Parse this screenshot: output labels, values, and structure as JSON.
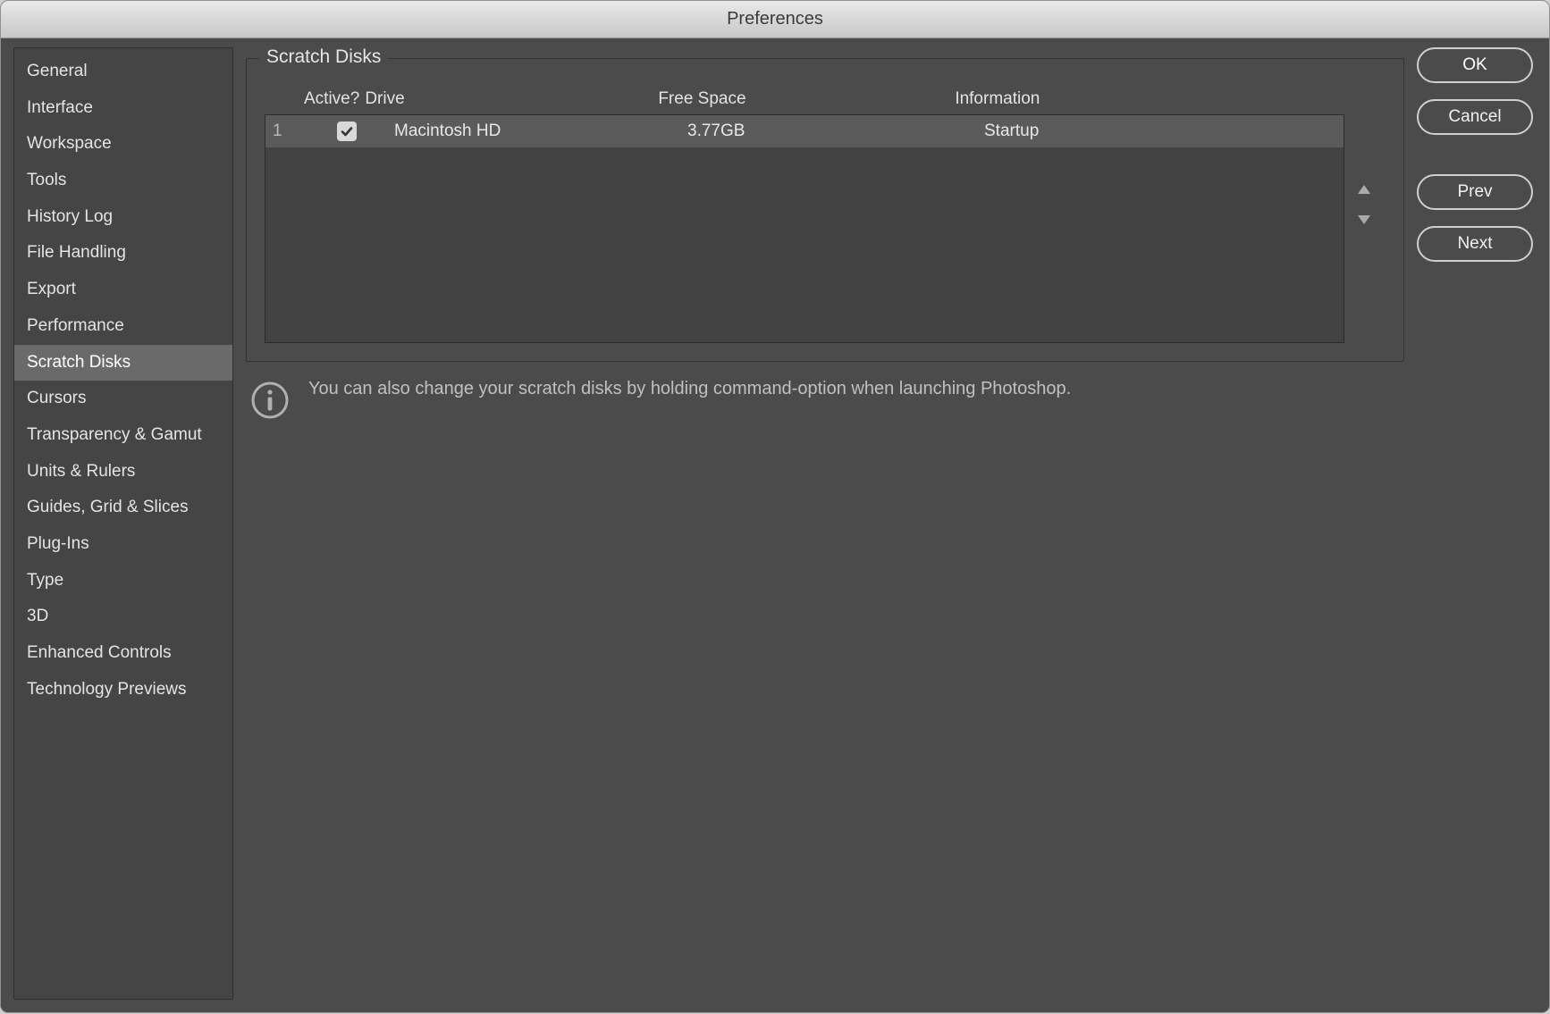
{
  "window": {
    "title": "Preferences"
  },
  "sidebar": {
    "items": [
      {
        "label": "General"
      },
      {
        "label": "Interface"
      },
      {
        "label": "Workspace"
      },
      {
        "label": "Tools"
      },
      {
        "label": "History Log"
      },
      {
        "label": "File Handling"
      },
      {
        "label": "Export"
      },
      {
        "label": "Performance"
      },
      {
        "label": "Scratch Disks",
        "selected": true
      },
      {
        "label": "Cursors"
      },
      {
        "label": "Transparency & Gamut"
      },
      {
        "label": "Units & Rulers"
      },
      {
        "label": "Guides, Grid & Slices"
      },
      {
        "label": "Plug-Ins"
      },
      {
        "label": "Type"
      },
      {
        "label": "3D"
      },
      {
        "label": "Enhanced Controls"
      },
      {
        "label": "Technology Previews"
      }
    ]
  },
  "panel": {
    "title": "Scratch Disks",
    "columns": {
      "active": "Active?",
      "drive": "Drive",
      "free": "Free Space",
      "info": "Information"
    },
    "rows": [
      {
        "num": "1",
        "active": true,
        "drive": "Macintosh HD",
        "free": "3.77GB",
        "info": "Startup"
      }
    ],
    "hint": "You can also change your scratch disks by holding command-option when launching Photoshop."
  },
  "buttons": {
    "ok": "OK",
    "cancel": "Cancel",
    "prev": "Prev",
    "next": "Next"
  }
}
